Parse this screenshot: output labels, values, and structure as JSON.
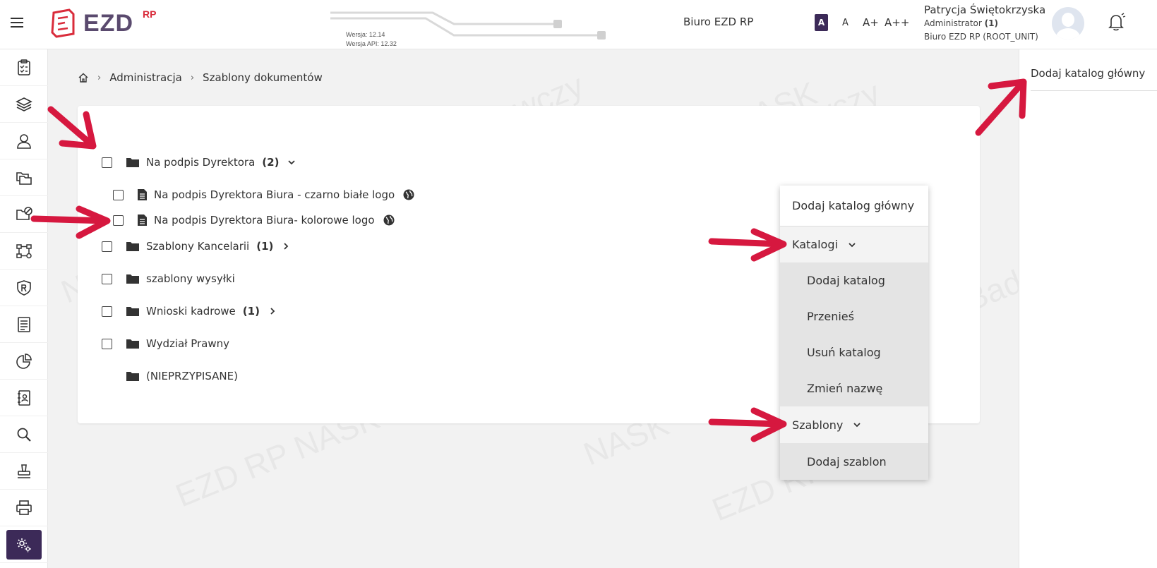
{
  "header": {
    "logo_text": "EZD",
    "logo_sup": "RP",
    "version": "Wersja: 12.14",
    "api_version": "Wersja API: 12.32",
    "office_name": "Biuro EZD RP",
    "font_sizes": [
      "A",
      "A",
      "A+",
      "A++"
    ],
    "user": {
      "name": "Patrycja Świętokrzyska",
      "role": "Administrator",
      "role_count": "(1)",
      "unit": "Biuro EZD RP (ROOT_UNIT)"
    }
  },
  "sidebar": {
    "items": [
      {
        "icon": "clipboard-check-icon"
      },
      {
        "icon": "layers-icon"
      },
      {
        "icon": "user-icon"
      },
      {
        "icon": "folders-icon"
      },
      {
        "icon": "folder-blocked-icon"
      },
      {
        "icon": "workflow-icon"
      },
      {
        "icon": "shield-r-icon"
      },
      {
        "icon": "document-list-icon"
      },
      {
        "icon": "pie-chart-icon"
      },
      {
        "icon": "address-book-icon"
      },
      {
        "icon": "search-icon"
      },
      {
        "icon": "stamp-icon"
      },
      {
        "icon": "printer-icon"
      },
      {
        "icon": "settings-icon",
        "active": true
      }
    ]
  },
  "breadcrumb": {
    "home": "home-icon",
    "items": [
      "Administracja",
      "Szablony dokumentów"
    ]
  },
  "right_panel": {
    "add_root_label": "Dodaj katalog główny"
  },
  "tree": [
    {
      "label": "Na podpis Dyrektora",
      "count": "(2)",
      "type": "folder",
      "expanded": true
    },
    {
      "label": "Na podpis Dyrektora Biura - czarno białe logo",
      "type": "doc",
      "public": true
    },
    {
      "label": "Na podpis Dyrektora Biura- kolorowe logo",
      "type": "doc",
      "public": true
    },
    {
      "label": "Szablony Kancelarii",
      "count": "(1)",
      "type": "folder",
      "expanded": false
    },
    {
      "label": "szablony wysyłki",
      "type": "folder"
    },
    {
      "label": "Wnioski kadrowe",
      "count": "(1)",
      "type": "folder",
      "expanded": false
    },
    {
      "label": "Wydział Prawny",
      "type": "folder"
    },
    {
      "label": "(NIEPRZYPISANE)",
      "type": "folder",
      "no_checkbox": true
    }
  ],
  "menu": {
    "add_root": "Dodaj katalog główny",
    "catalogs": "Katalogi",
    "add_catalog": "Dodaj katalog",
    "move": "Przenieś",
    "delete_catalog": "Usuń katalog",
    "rename": "Zmień nazwę",
    "templates": "Szablony",
    "add_template": "Dodaj szablon"
  },
  "watermark": [
    "NASK – Państwowy Instytut Badawczy",
    "EZD RP NASK"
  ],
  "colors": {
    "accent": "#3c2a58",
    "logo_red": "#d92b3a",
    "arrow": "#d6183f"
  }
}
